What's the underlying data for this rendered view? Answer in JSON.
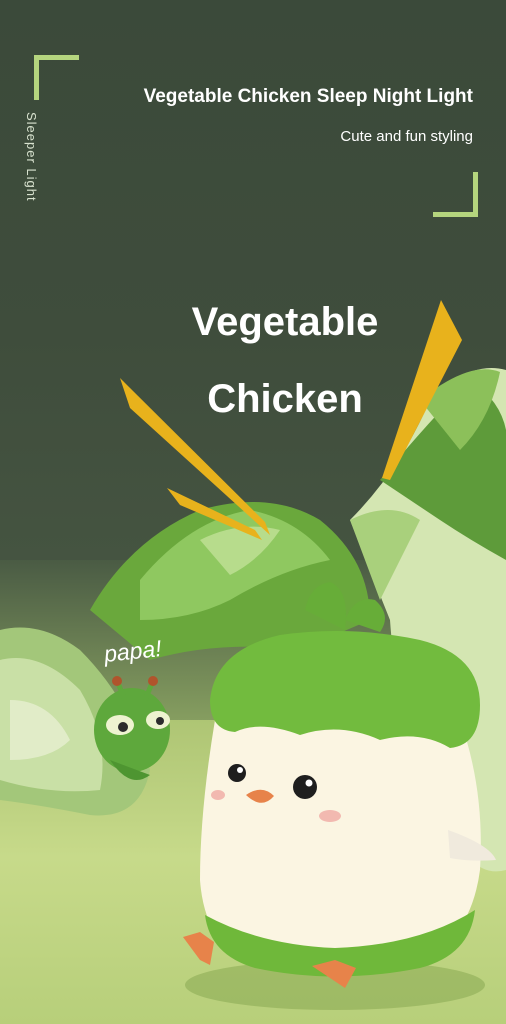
{
  "header": {
    "vertical_label": "Sleeper Light",
    "title": "Vegetable Chicken Sleep Night Light",
    "subtitle": "Cute and fun styling"
  },
  "hero": {
    "line1": "Vegetable",
    "line2": "Chicken",
    "bubble": "papa!"
  },
  "colors": {
    "background": "#3b4a3b",
    "accent_green": "#b5d57e",
    "zigzag_yellow": "#e8b21c",
    "chick_body": "#fbf5e2",
    "leaf_green": "#6fb83a"
  }
}
